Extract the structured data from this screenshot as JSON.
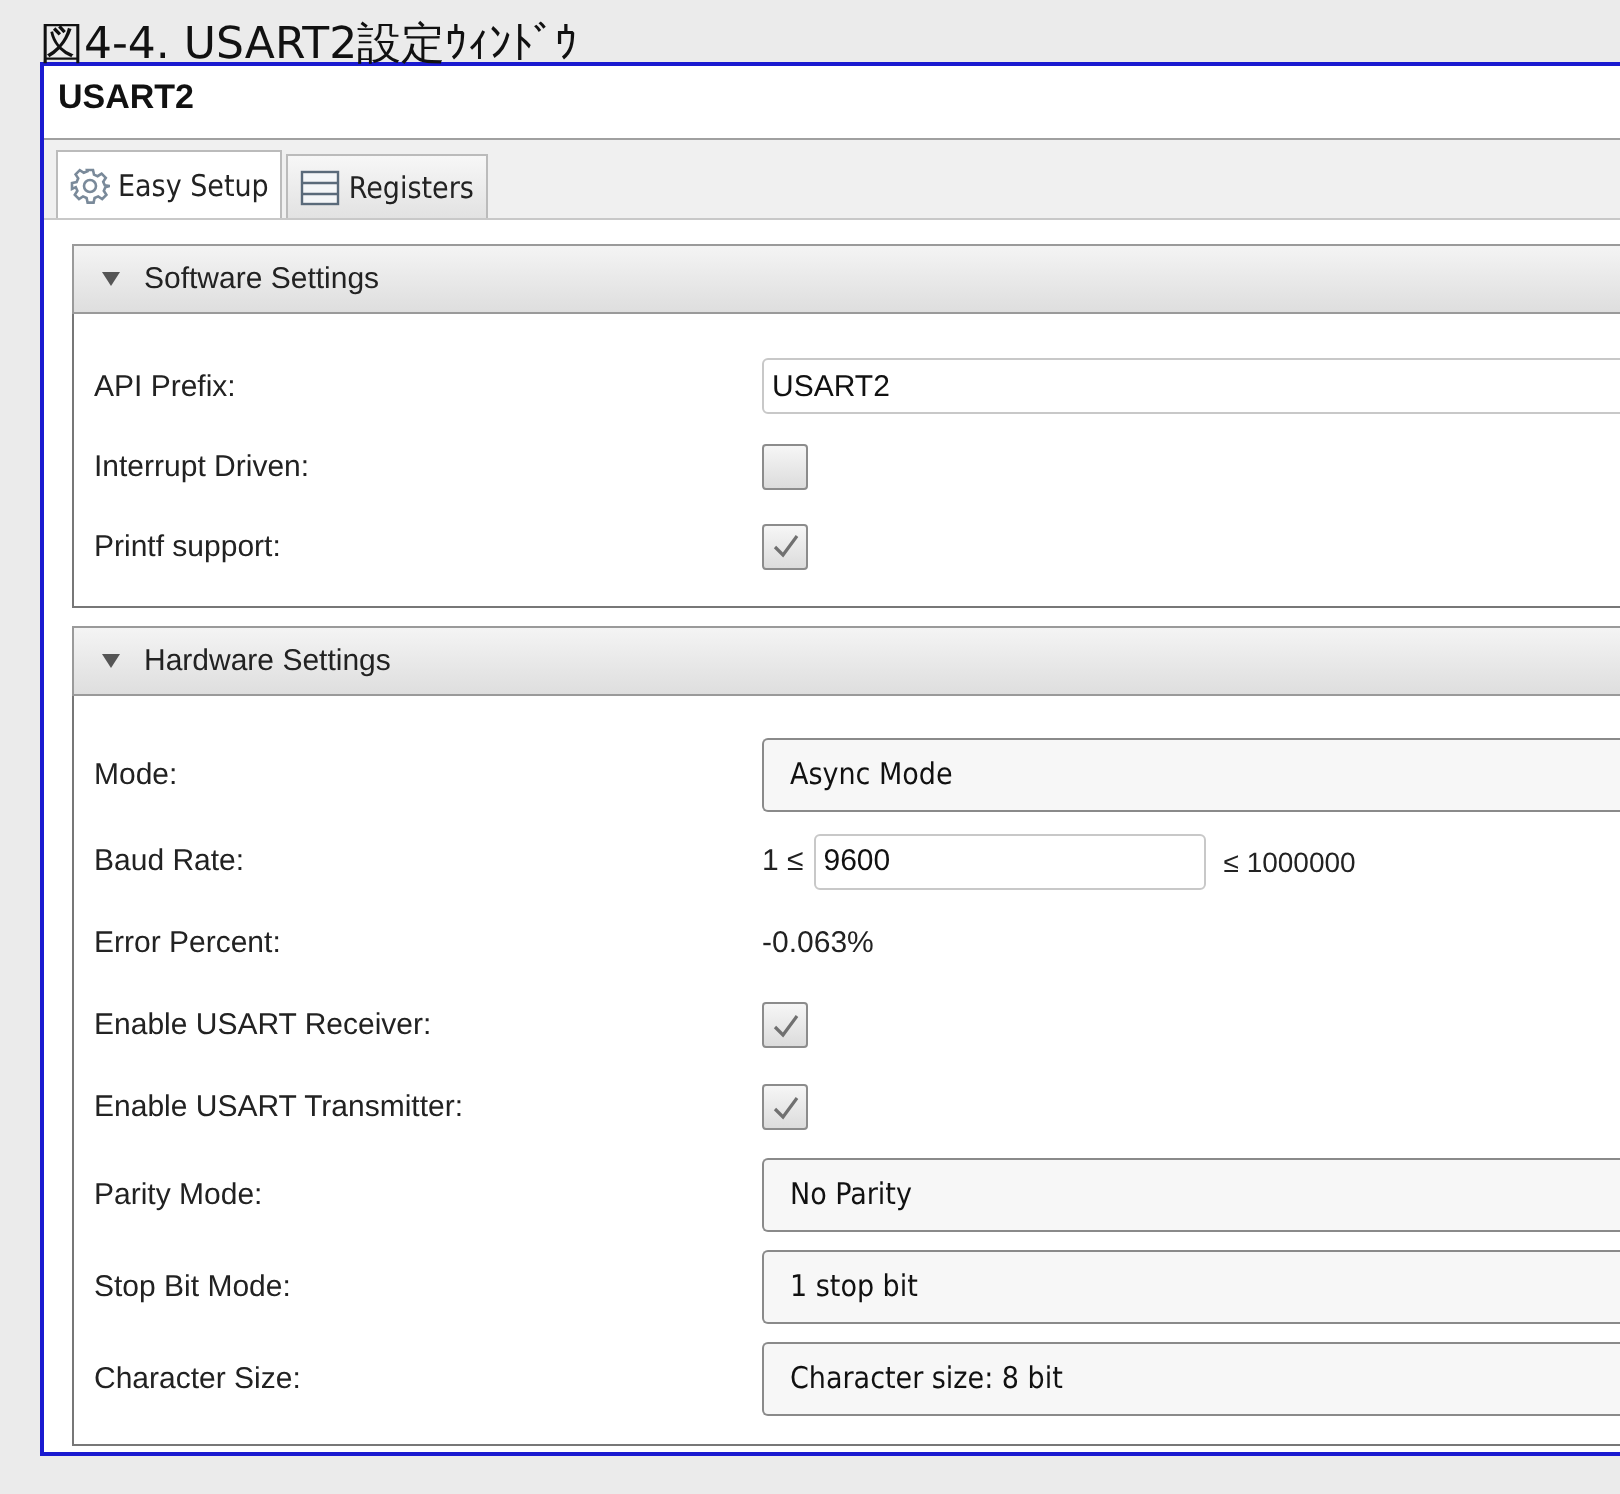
{
  "caption": "図4-4. USART2設定ｳｨﾝﾄﾞｳ",
  "window": {
    "title": "USART2"
  },
  "tabs": [
    {
      "label": "Easy Setup",
      "kind": "gear",
      "selected": true
    },
    {
      "label": "Registers",
      "kind": "list",
      "selected": false
    }
  ],
  "sections": [
    {
      "title": "Software Settings",
      "expanded": true,
      "rows": [
        {
          "kind": "text",
          "label": "API Prefix:",
          "value": "USART2"
        },
        {
          "kind": "checkbox",
          "label": "Interrupt Driven:",
          "checked": false
        },
        {
          "kind": "checkbox",
          "label": "Printf support:",
          "checked": true
        }
      ]
    },
    {
      "title": "Hardware Settings",
      "expanded": true,
      "rows": [
        {
          "kind": "dropdown",
          "label": "Mode:",
          "value": "Async Mode"
        },
        {
          "kind": "range",
          "label": "Baud Rate:",
          "prefix": "1 ≤",
          "value": "9600",
          "suffix": "≤ 1000000"
        },
        {
          "kind": "readout",
          "label": "Error Percent:",
          "value": "-0.063%"
        },
        {
          "kind": "checkbox",
          "label": "Enable USART Receiver:",
          "checked": true
        },
        {
          "kind": "checkbox",
          "label": "Enable USART Transmitter:",
          "checked": true
        },
        {
          "kind": "dropdown",
          "label": "Parity Mode:",
          "value": "No Parity"
        },
        {
          "kind": "dropdown",
          "label": "Stop Bit Mode:",
          "value": "1 stop bit"
        },
        {
          "kind": "dropdown",
          "label": "Character Size:",
          "value": "Character size: 8 bit"
        }
      ]
    }
  ]
}
